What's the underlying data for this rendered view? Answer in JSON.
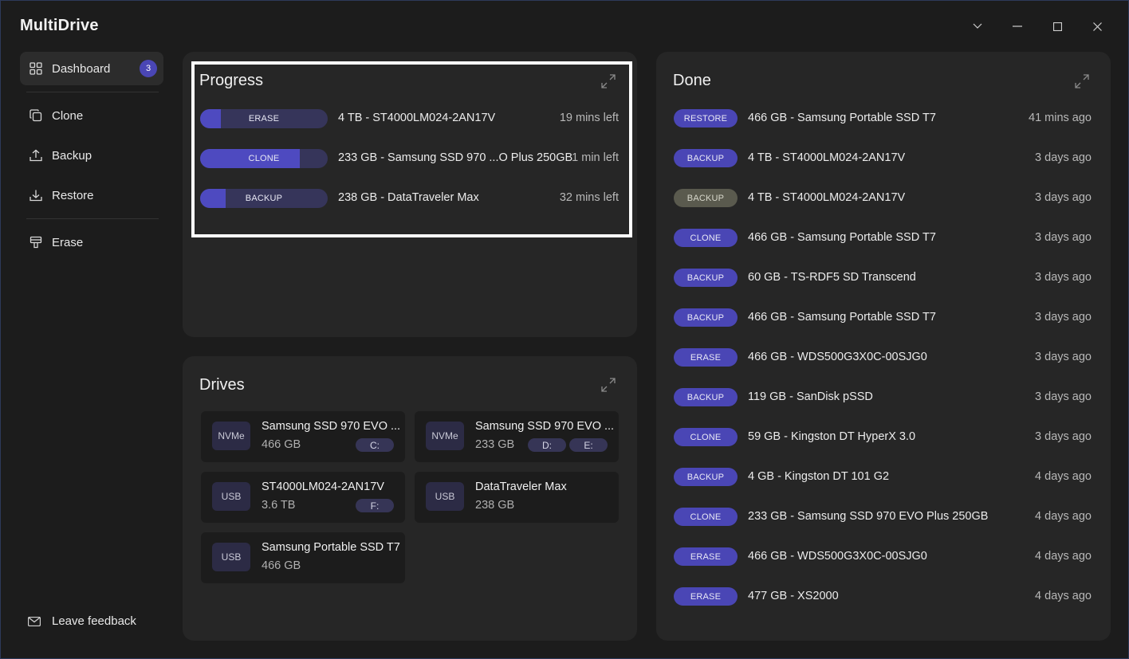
{
  "app": {
    "title": "MultiDrive"
  },
  "sidebar": {
    "items": [
      {
        "label": "Dashboard",
        "icon": "grid-icon",
        "badge": "3"
      },
      {
        "label": "Clone",
        "icon": "copy-icon"
      },
      {
        "label": "Backup",
        "icon": "upload-icon"
      },
      {
        "label": "Restore",
        "icon": "download-icon"
      },
      {
        "label": "Erase",
        "icon": "eraser-icon"
      }
    ],
    "feedback_label": "Leave feedback"
  },
  "progress": {
    "title": "Progress",
    "rows": [
      {
        "type": "ERASE",
        "progress": 0.16,
        "name": "4 TB - ST4000LM024-2AN17V",
        "time": "19 mins left"
      },
      {
        "type": "CLONE",
        "progress": 0.78,
        "name": "233 GB - Samsung SSD 970 ...O Plus 250GB",
        "time": "1 min left"
      },
      {
        "type": "BACKUP",
        "progress": 0.2,
        "name": "238 GB - DataTraveler Max",
        "time": "32 mins left"
      }
    ]
  },
  "drives": {
    "title": "Drives",
    "items": [
      {
        "type": "NVMe",
        "name": "Samsung SSD 970 EVO ...",
        "size": "466 GB",
        "letters": [
          "C:"
        ]
      },
      {
        "type": "NVMe",
        "name": "Samsung SSD 970 EVO ...",
        "size": "233 GB",
        "letters": [
          "D:",
          "E:"
        ]
      },
      {
        "type": "USB",
        "name": "ST4000LM024-2AN17V",
        "size": "3.6 TB",
        "letters": [
          "F:"
        ]
      },
      {
        "type": "USB",
        "name": "DataTraveler Max",
        "size": "238 GB",
        "letters": []
      },
      {
        "type": "USB",
        "name": "Samsung Portable SSD T7",
        "size": "466 GB",
        "letters": []
      }
    ]
  },
  "done": {
    "title": "Done",
    "rows": [
      {
        "type": "RESTORE",
        "name": "466 GB - Samsung Portable SSD T7",
        "time": "41 mins ago"
      },
      {
        "type": "BACKUP",
        "name": "4 TB - ST4000LM024-2AN17V",
        "time": "3 days ago"
      },
      {
        "type": "BACKUP",
        "name": "4 TB - ST4000LM024-2AN17V",
        "time": "3 days ago",
        "muted": true
      },
      {
        "type": "CLONE",
        "name": "466 GB - Samsung Portable SSD T7",
        "time": "3 days ago"
      },
      {
        "type": "BACKUP",
        "name": "60 GB - TS-RDF5 SD  Transcend",
        "time": "3 days ago"
      },
      {
        "type": "BACKUP",
        "name": "466 GB - Samsung Portable SSD T7",
        "time": "3 days ago"
      },
      {
        "type": "ERASE",
        "name": "466 GB - WDS500G3X0C-00SJG0",
        "time": "3 days ago"
      },
      {
        "type": "BACKUP",
        "name": "119 GB - SanDisk pSSD",
        "time": "3 days ago"
      },
      {
        "type": "CLONE",
        "name": "59 GB - Kingston DT HyperX 3.0",
        "time": "3 days ago"
      },
      {
        "type": "BACKUP",
        "name": "4 GB - Kingston DT 101 G2",
        "time": "4 days ago"
      },
      {
        "type": "CLONE",
        "name": "233 GB - Samsung SSD 970 EVO Plus 250GB",
        "time": "4 days ago"
      },
      {
        "type": "ERASE",
        "name": "466 GB - WDS500G3X0C-00SJG0",
        "time": "4 days ago"
      },
      {
        "type": "ERASE",
        "name": "477 GB - XS2000",
        "time": "4 days ago"
      }
    ]
  },
  "colors": {
    "accent": "#4a46b5",
    "muted_tag": "#5a5a4e",
    "panel": "#262626",
    "background": "#1c1c1c"
  }
}
